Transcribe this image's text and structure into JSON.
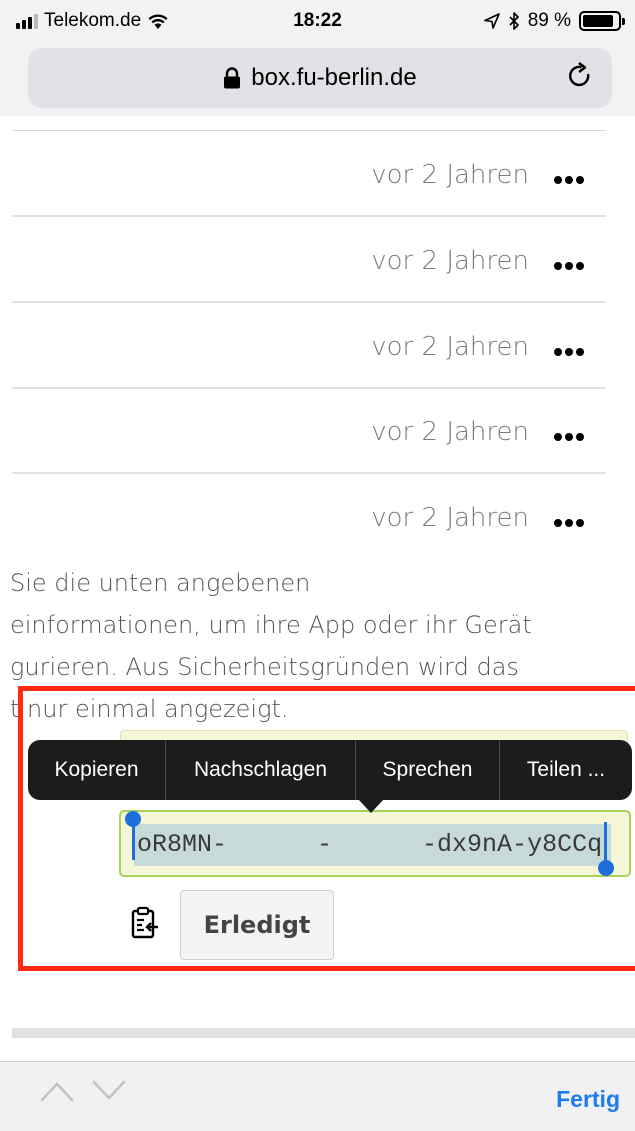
{
  "status_bar": {
    "carrier": "Telekom.de",
    "time": "18:22",
    "battery": "89 %",
    "battery_level": 0.89
  },
  "url_bar": {
    "url": "box.fu-berlin.de"
  },
  "list": {
    "rows": [
      {
        "time": "vor 2 Jahren"
      },
      {
        "time": "vor 2 Jahren"
      },
      {
        "time": "vor 2 Jahren"
      },
      {
        "time": "vor 2 Jahren"
      },
      {
        "time": "vor 2 Jahren"
      }
    ]
  },
  "info": {
    "lines": [
      "Sie die unten angebenen",
      "einformationen, um ihre App oder ihr Gerät",
      "gurieren. Aus Sicherheitsgründen wird das",
      "t nur einmal angezeigt."
    ]
  },
  "context_menu": {
    "items": [
      "Kopieren",
      "Nachschlagen",
      "Sprechen",
      "Teilen ..."
    ]
  },
  "token": {
    "value": "oR8MN-      -      -dx9nA-y8CCq"
  },
  "actions": {
    "done_label": "Erledigt"
  },
  "toolbar": {
    "done_label": "Fertig"
  },
  "colors": {
    "highlight": "#ff2a12",
    "accent": "#1d7cf2",
    "field_bg": "#f6f7d6",
    "field_border": "#a8d35a"
  }
}
